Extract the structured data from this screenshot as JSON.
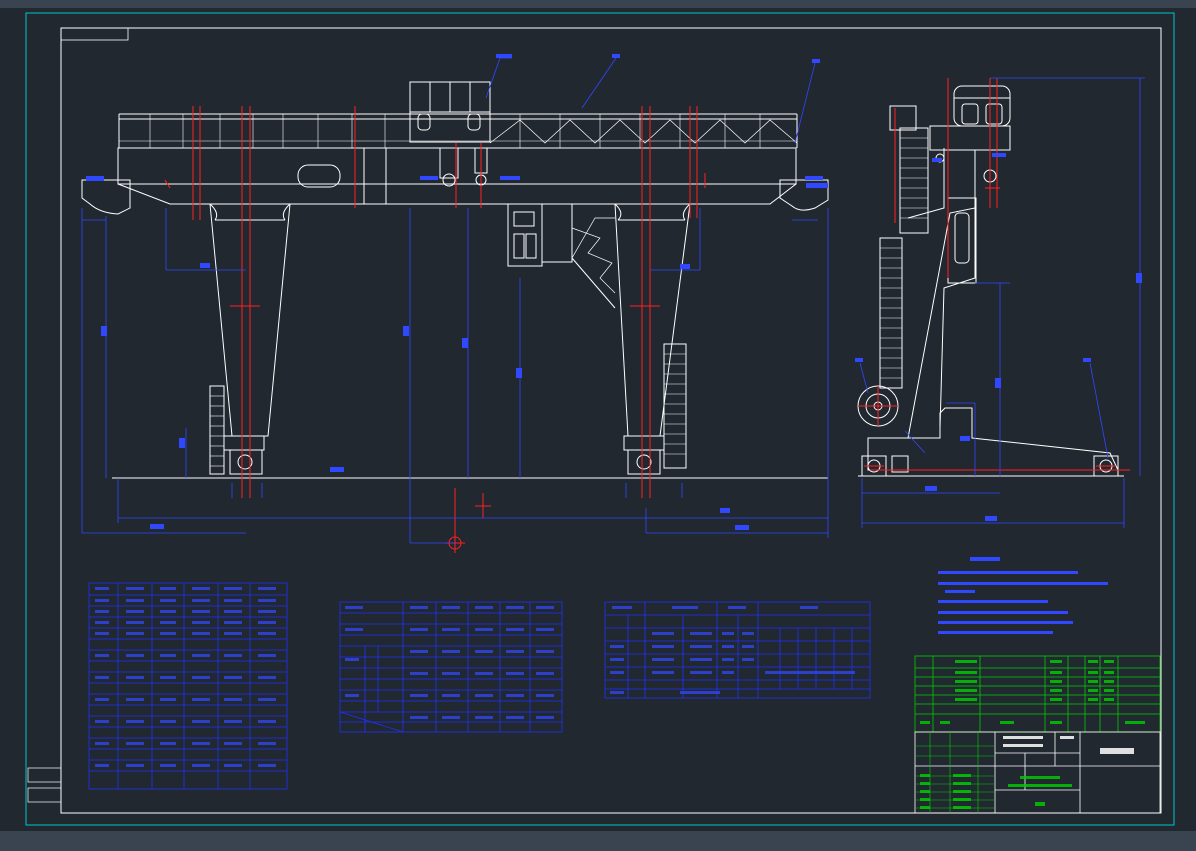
{
  "colors": {
    "background": "#212830",
    "frame_outer": "#00c8c8",
    "frame": "#ffffff",
    "structure": "#ffffff",
    "centerline": "#ff2020",
    "dimension": "#3048ff",
    "table_line": "#2030ff",
    "title_block": "#00d000",
    "toolbar": "#3a4350"
  },
  "drawing": {
    "stamp_label": "",
    "left_side_labels": [
      "",
      ""
    ]
  },
  "title_block": {
    "drawing_number": ""
  }
}
